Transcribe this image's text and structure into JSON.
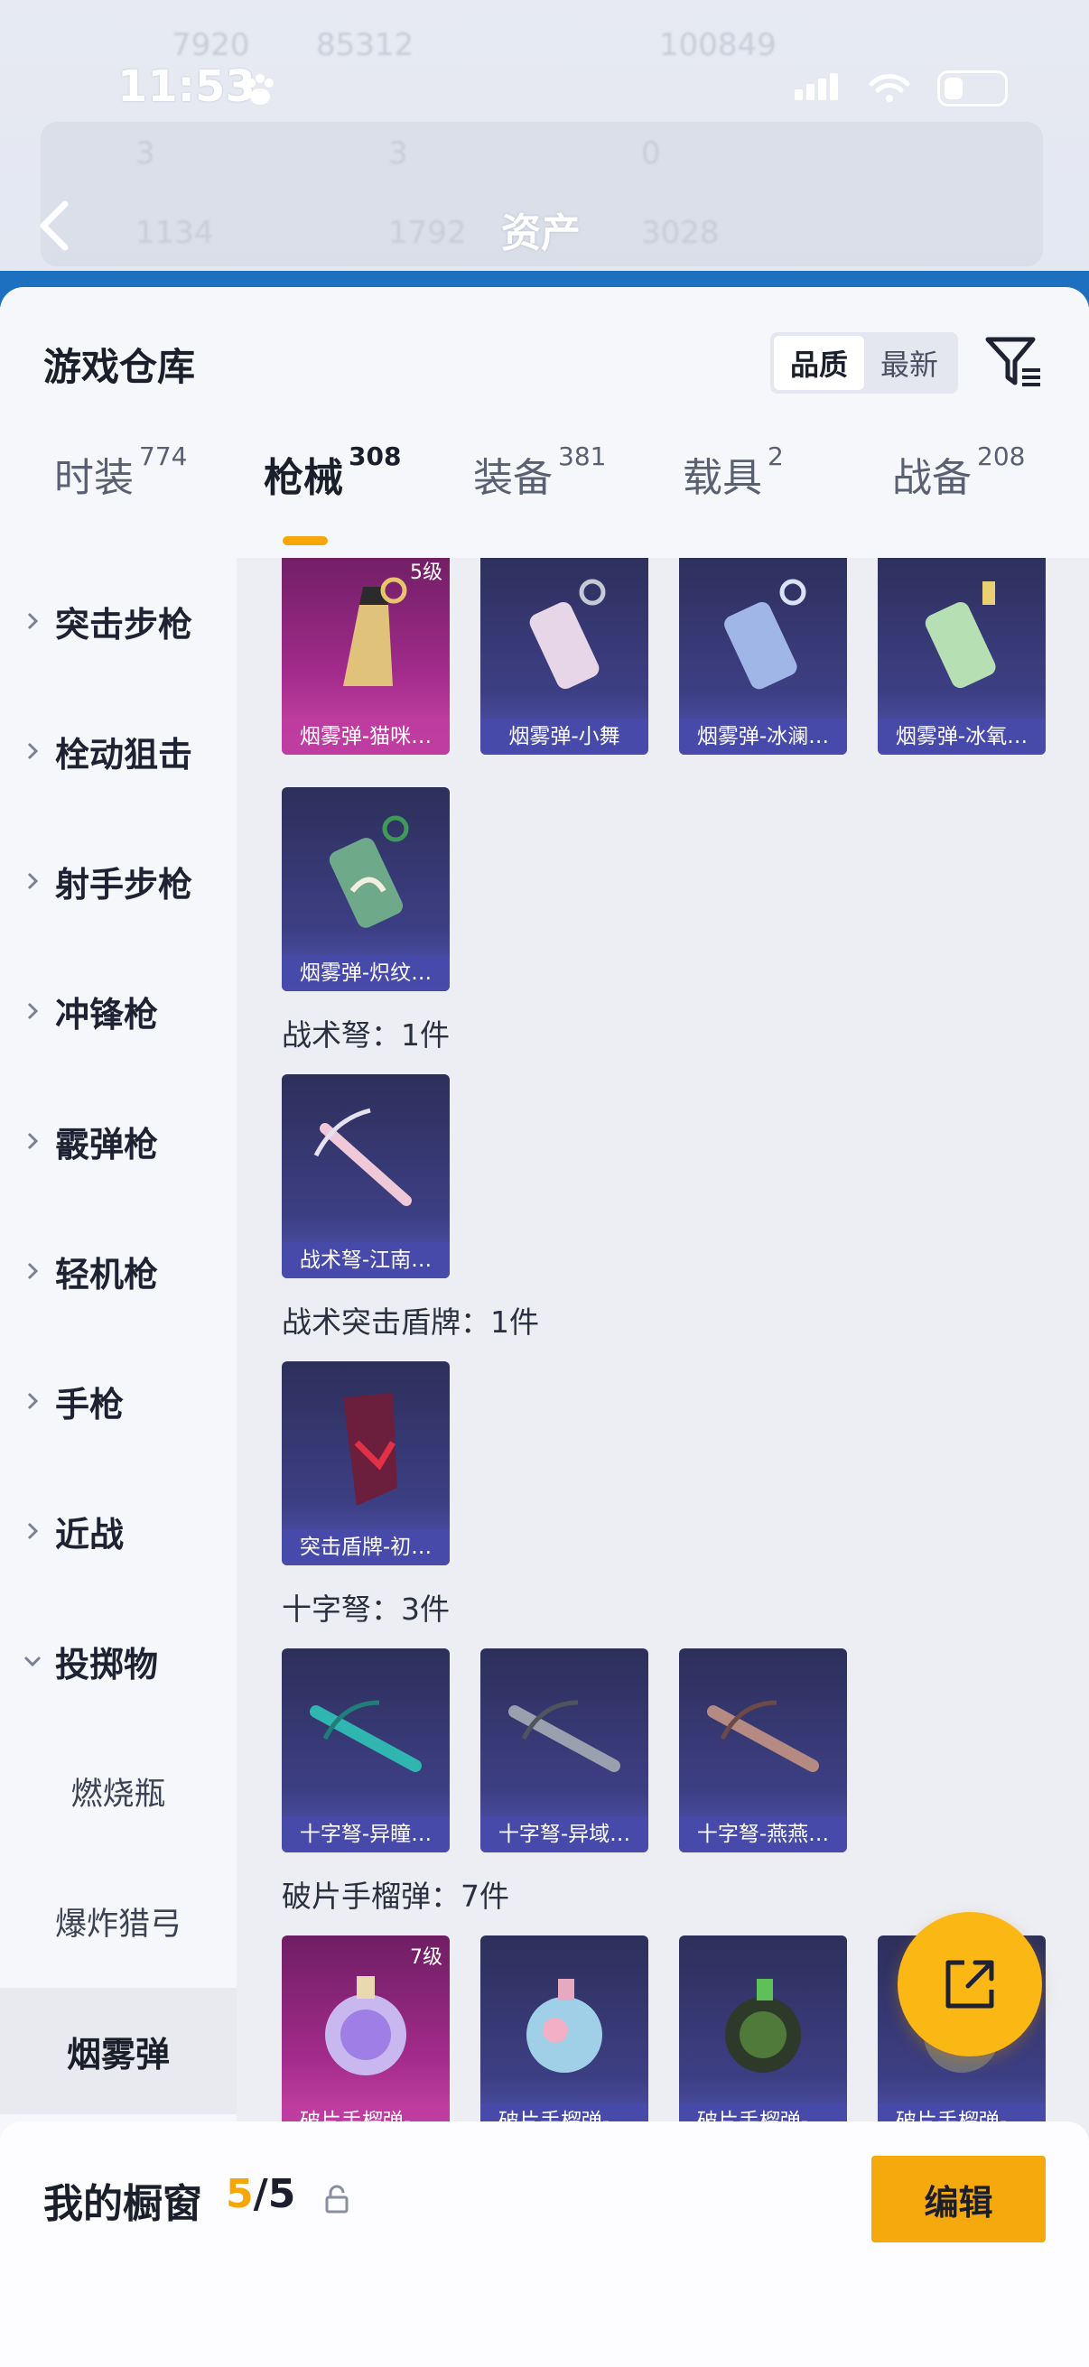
{
  "status": {
    "time": "11:53"
  },
  "header": {
    "title": "资产",
    "blurred_numbers": [
      "7920",
      "85312",
      "100849",
      "3",
      "3",
      "0",
      "1134",
      "1792",
      "3028"
    ]
  },
  "warehouse": {
    "title": "游戏仓库",
    "sort_options": [
      "品质",
      "最新"
    ],
    "active_sort": "品质"
  },
  "tabs": [
    {
      "label": "时装",
      "count": "774"
    },
    {
      "label": "枪械",
      "count": "308"
    },
    {
      "label": "装备",
      "count": "381"
    },
    {
      "label": "载具",
      "count": "2"
    },
    {
      "label": "战备",
      "count": "208"
    }
  ],
  "categories": [
    "突击步枪",
    "栓动狙击",
    "射手步枪",
    "冲锋枪",
    "霰弹枪",
    "轻机枪",
    "手枪",
    "近战",
    "投掷物"
  ],
  "subcategories": [
    "燃烧瓶",
    "爆炸猎弓",
    "烟雾弹"
  ],
  "active_subcategory": "烟雾弹",
  "smoke_cards": [
    {
      "name": "烟雾弹-猫咪…",
      "level": "5级",
      "rarity": "gold"
    },
    {
      "name": "烟雾弹-小舞",
      "rarity": "purple"
    },
    {
      "name": "烟雾弹-冰澜…",
      "rarity": "purple"
    },
    {
      "name": "烟雾弹-冰氧…",
      "rarity": "purple"
    },
    {
      "name": "烟雾弹-炽纹…",
      "rarity": "purple"
    }
  ],
  "sections": [
    {
      "heading": "战术弩：1件",
      "cards": [
        {
          "name": "战术弩-江南…"
        }
      ]
    },
    {
      "heading": "战术突击盾牌：1件",
      "cards": [
        {
          "name": "突击盾牌-初…"
        }
      ]
    },
    {
      "heading": "十字弩：3件",
      "cards": [
        {
          "name": "十字弩-异瞳…"
        },
        {
          "name": "十字弩-异域…"
        },
        {
          "name": "十字弩-燕燕…"
        }
      ]
    },
    {
      "heading": "破片手榴弹：7件",
      "cards": [
        {
          "name": "破片手榴弹-…",
          "level": "7级"
        },
        {
          "name": "破片手榴弹-…"
        },
        {
          "name": "破片手榴弹-…"
        },
        {
          "name": "破片手榴弹-…"
        }
      ]
    }
  ],
  "showcase": {
    "title": "我的橱窗",
    "current": "5",
    "total": "/5",
    "edit_label": "编辑"
  },
  "colors": {
    "accent": "#f5a70a",
    "edit_button": "#f6a90d",
    "card_purple": "#3d3f85",
    "card_gold": "#a22b8c"
  }
}
